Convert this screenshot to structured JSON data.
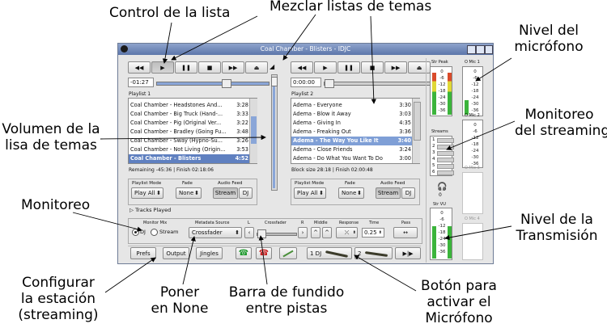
{
  "window": {
    "title": "Coal Chamber - Blisters - IDJC"
  },
  "annotations": {
    "control_lista": "Control de la lista",
    "mezclar_listas": "Mezclar listas de temas",
    "nivel_microfono_1": "Nivel del",
    "nivel_microfono_2": "micrófono",
    "volumen_1": "Volumen de la",
    "volumen_2": "lisa de temas",
    "monitoreo_streaming_1": "Monitoreo",
    "monitoreo_streaming_2": "del streaming",
    "monitoreo": "Monitoreo",
    "nivel_transmision_1": "Nivel de la",
    "nivel_transmision_2": "Transmisión",
    "configurar_1": "Configurar",
    "configurar_2": "la estación",
    "configurar_3": "(streaming)",
    "poner_1": "Poner",
    "poner_2": "en None",
    "barra_1": "Barra de fundido",
    "barra_2": "entre pistas",
    "boton_1": "Botón para",
    "boton_2": "activar el",
    "boton_3": "Micrófono"
  },
  "player1": {
    "time": "-01:27",
    "playlist_label": "Playlist 1",
    "tracks": [
      {
        "title": "Coal Chamber - Headstones And...",
        "duration": "3:28"
      },
      {
        "title": "Coal Chamber - Big Truck (Hand-...",
        "duration": "3:33"
      },
      {
        "title": "Coal Chamber - Pig (Original Ver...",
        "duration": "3:22"
      },
      {
        "title": "Coal Chamber - Bradley (Going Fu...",
        "duration": "3:48"
      },
      {
        "title": "Coal Chamber - Sway (Hypno-Su...",
        "duration": "3:26"
      },
      {
        "title": "Coal Chamber - Not Living (Origin...",
        "duration": "3:53"
      },
      {
        "title": "Coal Chamber - Blisters",
        "duration": "4:52"
      }
    ],
    "status": "Remaining -45:36 | Finish 02:18:06",
    "mode_label": "Playlist Mode",
    "mode_value": "Play All",
    "fade_label": "Fade",
    "fade_value": "None",
    "audio_feed_label": "Audio Feed",
    "stream_btn": "Stream",
    "dj_btn": "DJ"
  },
  "player2": {
    "time": "0:00:00",
    "playlist_label": "Playlist 2",
    "tracks": [
      {
        "title": "Adema - Everyone",
        "duration": "3:30"
      },
      {
        "title": "Adema - Blow it Away",
        "duration": "3:03"
      },
      {
        "title": "Adema - Giving In",
        "duration": "4:35"
      },
      {
        "title": "Adema - Freaking Out",
        "duration": "3:36"
      },
      {
        "title": "Adema - The Way You Like It",
        "duration": "3:40"
      },
      {
        "title": "Adema - Close Friends",
        "duration": "3:24"
      },
      {
        "title": "Adema - Do What You Want To Do",
        "duration": "3:00"
      }
    ],
    "status": "Block size 28:18 | Finish 02:00:48",
    "mode_label": "Playlist Mode",
    "mode_value": "Play All",
    "fade_label": "Fade",
    "fade_value": "None",
    "audio_feed_label": "Audio Feed",
    "stream_btn": "Stream",
    "dj_btn": "DJ"
  },
  "tracks_played": "Tracks Played",
  "mixer": {
    "monitor_mix_label": "Monitor Mix",
    "dj_radio": "DJ",
    "stream_radio": "Stream",
    "metadata_source_label": "Metadata Source",
    "metadata_source_value": "Crossfader",
    "l_label": "L",
    "crossfader_label": "Crossfader",
    "r_label": "R",
    "middle_label": "Middle",
    "response_label": "Response",
    "time_label": "Time",
    "time_value": "0.25",
    "pass_label": "Pass"
  },
  "bottom_bar": {
    "prefs": "Prefs",
    "output": "Output",
    "jingles": "Jingles",
    "mic1": "1 DJ",
    "mic2": "2"
  },
  "meters": {
    "str_peak_label": "Str Peak",
    "omic1_label": "O Mic 1",
    "omic2_label": "O Mic 2",
    "omic3_label": "O Mic 3",
    "omic4_label": "O Mic 4",
    "streams_label": "Streams",
    "streams": [
      "1",
      "2",
      "3",
      "4",
      "5",
      "6"
    ],
    "headphone_value": "0",
    "str_vu_label": "Str VU",
    "scale": [
      "0",
      "-6",
      "-12",
      "-18",
      "-24",
      "-30",
      "-36"
    ]
  }
}
